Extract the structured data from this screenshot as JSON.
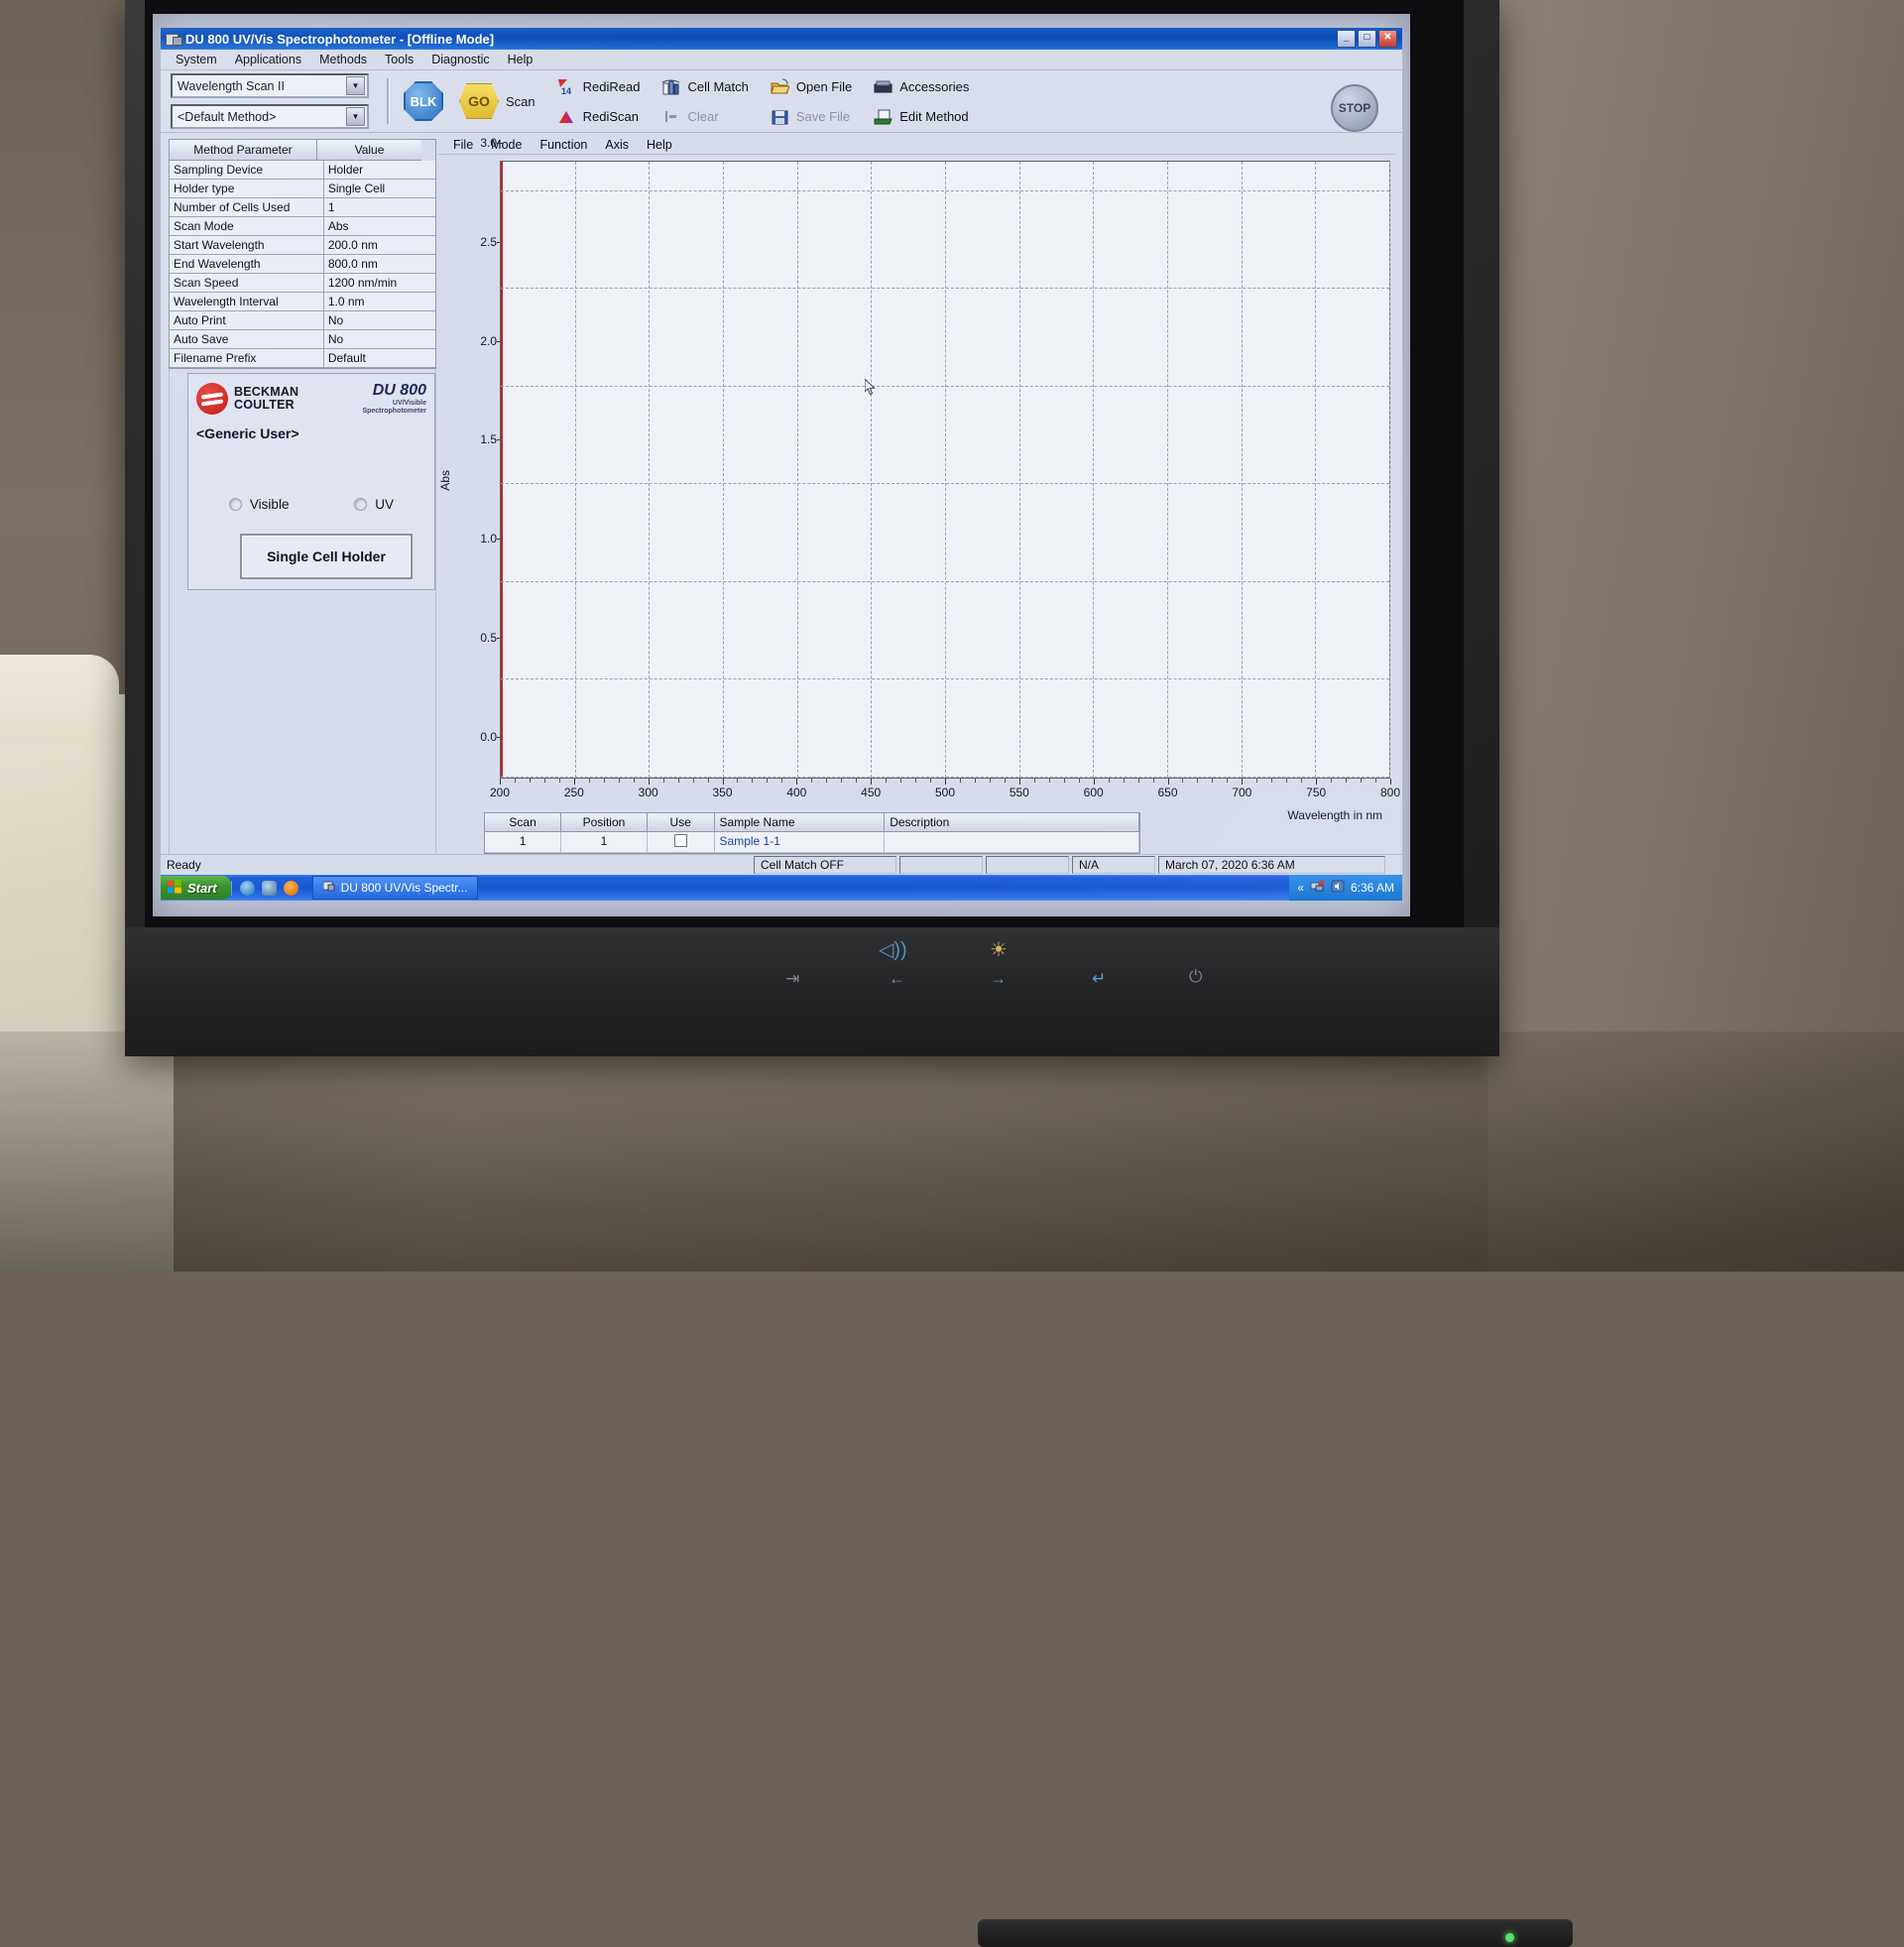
{
  "window": {
    "title": "DU 800 UV/Vis Spectrophotometer - [Offline Mode]",
    "icon": "app-icon",
    "minimize": "_",
    "maximize": "□",
    "close": "✕"
  },
  "menubar": [
    "System",
    "Applications",
    "Methods",
    "Tools",
    "Diagnostic",
    "Help"
  ],
  "toolbar": {
    "method_type": "Wavelength Scan II",
    "method_name": "<Default Method>",
    "blk_label": "BLK",
    "go_label": "GO",
    "scan_label": "Scan",
    "stop_label": "STOP",
    "items": [
      {
        "label": "RediRead",
        "icon": "rediread-icon",
        "enabled": true
      },
      {
        "label": "Cell Match",
        "icon": "cellmatch-icon",
        "enabled": true
      },
      {
        "label": "Open File",
        "icon": "open-folder-icon",
        "enabled": true
      },
      {
        "label": "Accessories",
        "icon": "accessories-icon",
        "enabled": true
      },
      {
        "label": "RediScan",
        "icon": "rediscan-icon",
        "enabled": true
      },
      {
        "label": "Clear",
        "icon": "clear-icon",
        "enabled": false
      },
      {
        "label": "Save File",
        "icon": "save-disk-icon",
        "enabled": false
      },
      {
        "label": "Edit Method",
        "icon": "edit-method-icon",
        "enabled": true
      }
    ]
  },
  "method_table": {
    "headers": [
      "Method Parameter",
      "Value"
    ],
    "rows": [
      [
        "Sampling Device",
        "Holder"
      ],
      [
        "Holder type",
        "Single Cell"
      ],
      [
        "Number of Cells Used",
        "1"
      ],
      [
        "Scan Mode",
        "Abs"
      ],
      [
        "Start Wavelength",
        "200.0 nm"
      ],
      [
        "End Wavelength",
        "800.0 nm"
      ],
      [
        "Scan Speed",
        "1200 nm/min"
      ],
      [
        "Wavelength Interval",
        "1.0 nm"
      ],
      [
        "Auto Print",
        "No"
      ],
      [
        "Auto Save",
        "No"
      ],
      [
        "Filename Prefix",
        "Default"
      ]
    ]
  },
  "brand": {
    "company_line1": "BECKMAN",
    "company_line2": "COULTER",
    "model": "DU 800",
    "sub1": "UV/Visible",
    "sub2": "Spectrophotometer",
    "user": "<Generic User>",
    "lamp_visible": "Visible",
    "lamp_uv": "UV",
    "holder_button": "Single Cell Holder",
    "logo_color": "#c01812"
  },
  "chart_menu": [
    "File",
    "Mode",
    "Function",
    "Axis",
    "Help"
  ],
  "chart_data": {
    "type": "line",
    "title": "",
    "xlabel": "Wavelength in nm",
    "ylabel": "Abs",
    "xlim": [
      200,
      800
    ],
    "ylim": [
      0.0,
      3.15
    ],
    "xticks": [
      200,
      250,
      300,
      350,
      400,
      450,
      500,
      550,
      600,
      650,
      700,
      750,
      800
    ],
    "xtick_labels": [
      "200",
      "250",
      "300",
      "350",
      "400",
      "450",
      "500",
      "550",
      "600",
      "650",
      "700",
      "750",
      "800"
    ],
    "yticks": [
      0.0,
      0.5,
      1.0,
      1.5,
      2.0,
      2.5,
      3.0
    ],
    "ytick_labels": [
      "0.0",
      "0.5",
      "1.0",
      "1.5",
      "2.0",
      "2.5",
      "3.0"
    ],
    "grid": true,
    "legend": "none",
    "series": [
      {
        "name": "Sample 1-1",
        "color": "#c32020",
        "x": [],
        "y": []
      }
    ],
    "note": "Empty plot - no spectrum acquired (offline mode)"
  },
  "scan_table": {
    "headers": [
      "Scan",
      "Position",
      "Use",
      "Sample Name",
      "Description"
    ],
    "rows": [
      {
        "scan": "1",
        "position": "1",
        "use": false,
        "sample_name": "Sample 1-1",
        "description": ""
      }
    ]
  },
  "statusbar": {
    "ready": "Ready",
    "cell_match": "Cell Match OFF",
    "field_blank1": "",
    "field_blank2": "",
    "na": "N/A",
    "datetime": "March 07, 2020 6:36 AM"
  },
  "taskbar": {
    "start": "Start",
    "task": "DU 800 UV/Vis Spectr...",
    "clock": "6:36 AM",
    "tray_arrow": "«"
  },
  "monitor": {
    "controls": [
      "speaker-icon",
      "brightness-icon",
      "input-icon",
      "left-icon",
      "right-icon",
      "enter-icon",
      "power-icon"
    ]
  }
}
